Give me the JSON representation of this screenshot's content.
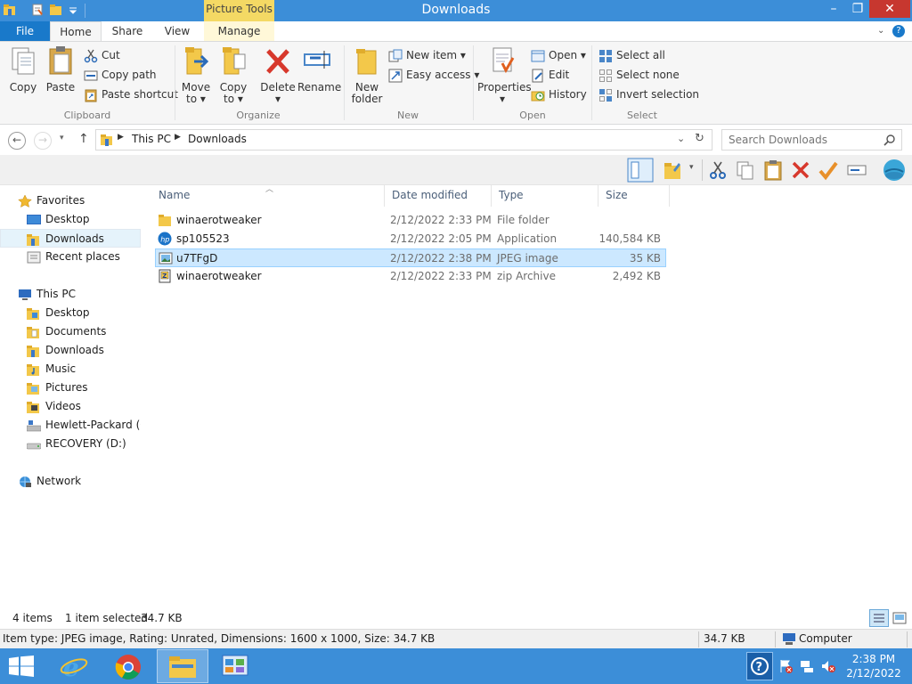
{
  "window": {
    "title": "Downloads",
    "context_tab_group": "Picture Tools",
    "controls": {
      "minimize": "–",
      "maximize": "❐",
      "close": "✕"
    }
  },
  "ribbon_tabs": [
    {
      "label": "File"
    },
    {
      "label": "Home"
    },
    {
      "label": "Share"
    },
    {
      "label": "View"
    },
    {
      "label": "Manage"
    }
  ],
  "ribbon": {
    "clipboard": {
      "group_label": "Clipboard",
      "copy": "Copy",
      "paste": "Paste",
      "cut": "Cut",
      "copy_path": "Copy path",
      "paste_shortcut": "Paste shortcut"
    },
    "organize": {
      "group_label": "Organize",
      "move_to": [
        "Move",
        "to ▾"
      ],
      "copy_to": [
        "Copy",
        "to ▾"
      ],
      "delete": [
        "Delete",
        "▾"
      ],
      "rename": "Rename"
    },
    "new": {
      "group_label": "New",
      "new_folder": [
        "New",
        "folder"
      ],
      "new_item": "New item ▾",
      "easy_access": "Easy access ▾"
    },
    "open": {
      "group_label": "Open",
      "properties": [
        "Properties",
        "▾"
      ],
      "open": "Open ▾",
      "edit": "Edit",
      "history": "History"
    },
    "select": {
      "group_label": "Select",
      "select_all": "Select all",
      "select_none": "Select none",
      "invert_selection": "Invert selection"
    }
  },
  "address_bar": {
    "crumbs": [
      "This PC",
      "Downloads"
    ],
    "search_placeholder": "Search Downloads"
  },
  "nav_pane": {
    "favorites_header": "Favorites",
    "favorites": [
      {
        "label": "Desktop"
      },
      {
        "label": "Downloads"
      },
      {
        "label": "Recent places"
      }
    ],
    "this_pc_header": "This PC",
    "this_pc": [
      {
        "label": "Desktop"
      },
      {
        "label": "Documents"
      },
      {
        "label": "Downloads"
      },
      {
        "label": "Music"
      },
      {
        "label": "Pictures"
      },
      {
        "label": "Videos"
      },
      {
        "label": "Hewlett-Packard (C:"
      },
      {
        "label": "RECOVERY (D:)"
      }
    ],
    "network": "Network"
  },
  "file_list": {
    "columns": [
      "Name",
      "Date modified",
      "Type",
      "Size"
    ],
    "rows": [
      {
        "name": "winaerotweaker",
        "date": "2/12/2022 2:33 PM",
        "type": "File folder",
        "size": ""
      },
      {
        "name": "sp105523",
        "date": "2/12/2022 2:05 PM",
        "type": "Application",
        "size": "140,584 KB"
      },
      {
        "name": "u7TFgD",
        "date": "2/12/2022 2:38 PM",
        "type": "JPEG image",
        "size": "35 KB"
      },
      {
        "name": "winaerotweaker",
        "date": "2/12/2022 2:33 PM",
        "type": "zip Archive",
        "size": "2,492 KB"
      }
    ],
    "selected_index": 2
  },
  "status_bar": {
    "item_count": "4 items",
    "selection": "1 item selected",
    "selection_size": "34.7 KB"
  },
  "info_bar": {
    "details": "Item type: JPEG image, Rating: Unrated, Dimensions: 1600 x 1000, Size: 34.7 KB",
    "size": "34.7 KB",
    "location": "Computer"
  },
  "taskbar": {
    "clock_time": "2:38 PM",
    "clock_date": "2/12/2022"
  },
  "colors": {
    "titlebar": "#3c8ed8",
    "file_tab": "#1979ca",
    "picture_tools": "#f4d964",
    "selection": "#cce8ff",
    "close_button": "#c7372f"
  }
}
